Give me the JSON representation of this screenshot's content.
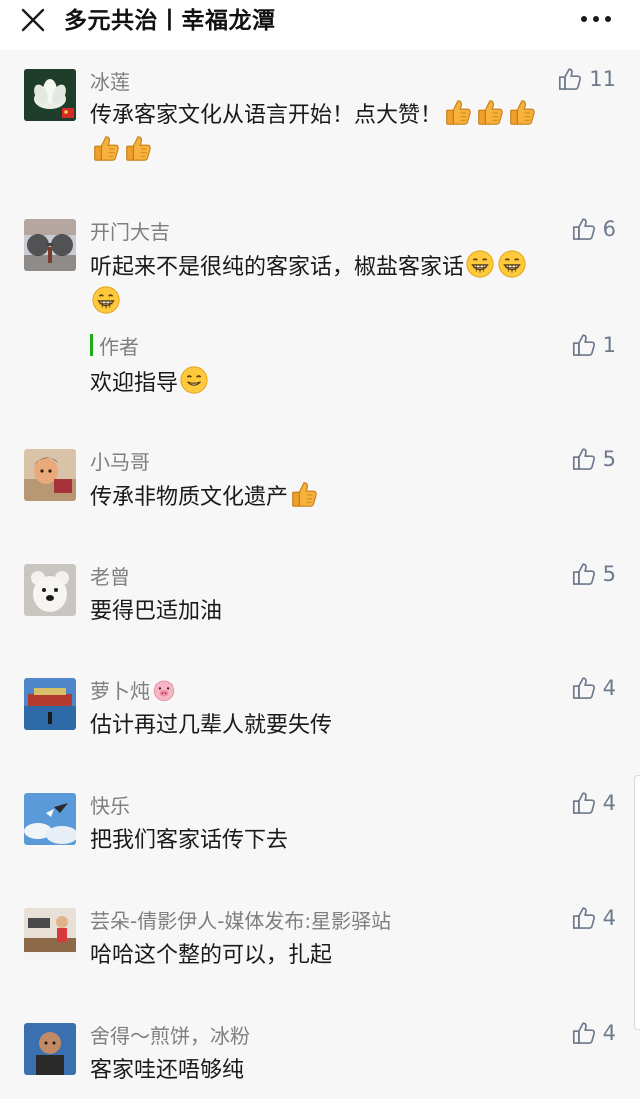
{
  "header": {
    "title": "多元共治丨幸福龙潭",
    "close_icon": "close-icon",
    "more_icon": "more-horizontal-icon"
  },
  "comments": [
    {
      "nickname": "冰莲",
      "text": "传承客家文化从语言开始！点大赞！",
      "likes": "11",
      "emojis": [
        "thumbs-up",
        "thumbs-up",
        "thumbs-up",
        "thumbs-up",
        "thumbs-up"
      ]
    },
    {
      "nickname": "开门大吉",
      "text": "听起来不是很纯的客家话，椒盐客家话",
      "likes": "6",
      "emojis": [
        "grinning-face",
        "grinning-face",
        "grinning-face"
      ],
      "reply": {
        "author_label": "作者",
        "text": "欢迎指导",
        "likes": "1",
        "emojis": [
          "smiling-face"
        ]
      }
    },
    {
      "nickname": "小马哥",
      "text": "传承非物质文化遗产",
      "likes": "5",
      "emojis": [
        "thumbs-up"
      ]
    },
    {
      "nickname": "老曾",
      "text": "要得巴适加油",
      "likes": "5"
    },
    {
      "nickname": "萝卜炖",
      "text": "估计再过几辈人就要失传",
      "likes": "4",
      "nickname_emoji": "pig-face"
    },
    {
      "nickname": "快乐",
      "text": "把我们客家话传下去",
      "likes": "4"
    },
    {
      "nickname": "芸朵-倩影伊人-媒体发布:星影驿站",
      "text": "哈哈这个整的可以，扎起",
      "likes": "4"
    },
    {
      "nickname": "舍得～煎饼，冰粉",
      "text": "客家哇还唔够纯",
      "likes": "4"
    }
  ],
  "colors": {
    "background": "#f7f7f7",
    "nickname": "#7f7f7f",
    "like": "#6d7a8c",
    "author_bar": "#1aad19"
  }
}
